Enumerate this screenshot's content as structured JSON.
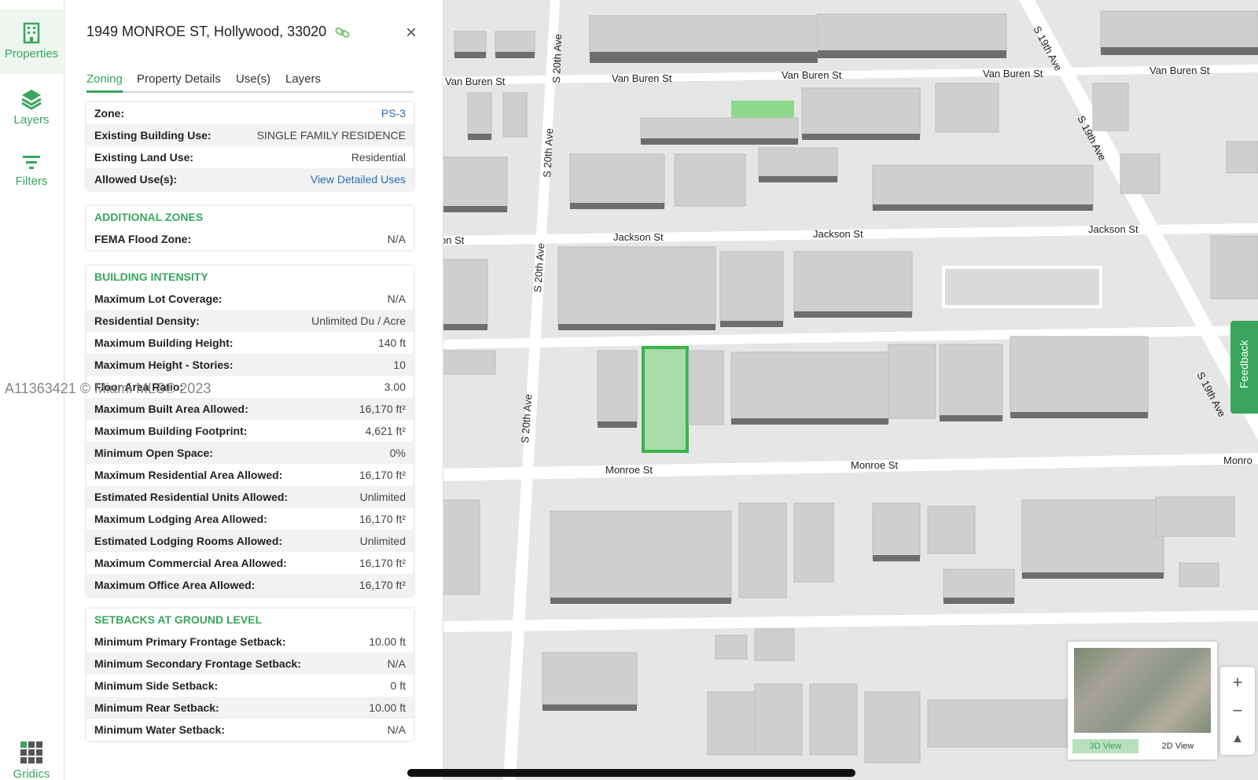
{
  "rail": {
    "properties": "Properties",
    "layers": "Layers",
    "filters": "Filters",
    "gridics": "Gridics"
  },
  "panel": {
    "address": "1949 MONROE ST, Hollywood, 33020",
    "tabs": [
      "Zoning",
      "Property Details",
      "Use(s)",
      "Layers"
    ],
    "zoning": [
      {
        "k": "Zone:",
        "v": "PS-3"
      },
      {
        "k": "Existing Building Use:",
        "v": "SINGLE FAMILY RESIDENCE"
      },
      {
        "k": "Existing Land Use:",
        "v": "Residential"
      },
      {
        "k": "Allowed Use(s):",
        "v": "View Detailed Uses"
      }
    ],
    "additional_zones": {
      "title": "ADDITIONAL ZONES",
      "rows": [
        {
          "k": "FEMA Flood Zone:",
          "v": "N/A"
        }
      ]
    },
    "building_intensity": {
      "title": "BUILDING INTENSITY",
      "rows": [
        {
          "k": "Maximum Lot Coverage:",
          "v": "N/A"
        },
        {
          "k": "Residential Density:",
          "v": "Unlimited Du / Acre"
        },
        {
          "k": "Maximum Building Height:",
          "v": "140 ft"
        },
        {
          "k": "Maximum Height - Stories:",
          "v": "10"
        },
        {
          "k": "Floor Area Ratio:",
          "v": "3.00"
        },
        {
          "k": "Maximum Built Area Allowed:",
          "v": "16,170 ft²"
        },
        {
          "k": "Maximum Building Footprint:",
          "v": "4,621 ft²"
        },
        {
          "k": "Minimum Open Space:",
          "v": "0%"
        },
        {
          "k": "Maximum Residential Area Allowed:",
          "v": "16,170 ft²"
        },
        {
          "k": "Estimated Residential Units Allowed:",
          "v": "Unlimited"
        },
        {
          "k": "Maximum Lodging Area Allowed:",
          "v": "16,170 ft²"
        },
        {
          "k": "Estimated Lodging Rooms Allowed:",
          "v": "Unlimited"
        },
        {
          "k": "Maximum Commercial Area Allowed:",
          "v": "16,170 ft²"
        },
        {
          "k": "Maximum Office Area Allowed:",
          "v": "16,170 ft²"
        }
      ]
    },
    "setbacks": {
      "title": "SETBACKS AT GROUND LEVEL",
      "rows": [
        {
          "k": "Minimum Primary Frontage Setback:",
          "v": "10.00 ft"
        },
        {
          "k": "Minimum Secondary Frontage Setback:",
          "v": "N/A"
        },
        {
          "k": "Minimum Side Setback:",
          "v": "0 ft"
        },
        {
          "k": "Minimum Rear Setback:",
          "v": "10.00 ft"
        },
        {
          "k": "Minimum Water Setback:",
          "v": "N/A"
        }
      ]
    }
  },
  "map": {
    "streets": {
      "van_buren": "Van Buren St",
      "jackson": "Jackson St",
      "monroe": "Monroe St",
      "s20": "S 20th Ave",
      "s19": "S 19th Ave",
      "jackson_partial": "on St",
      "monroe_partial": "Monro"
    },
    "feedback": "Feedback",
    "minimap": {
      "view3d": "3D View",
      "view2d": "2D View"
    },
    "colors": {
      "accent": "#3aa55d",
      "selected_parcel": "#3ab34a",
      "road": "#ffffff",
      "block": "#e6e6e6"
    }
  },
  "watermark": "A11363421 © Miami MLS® 2023"
}
